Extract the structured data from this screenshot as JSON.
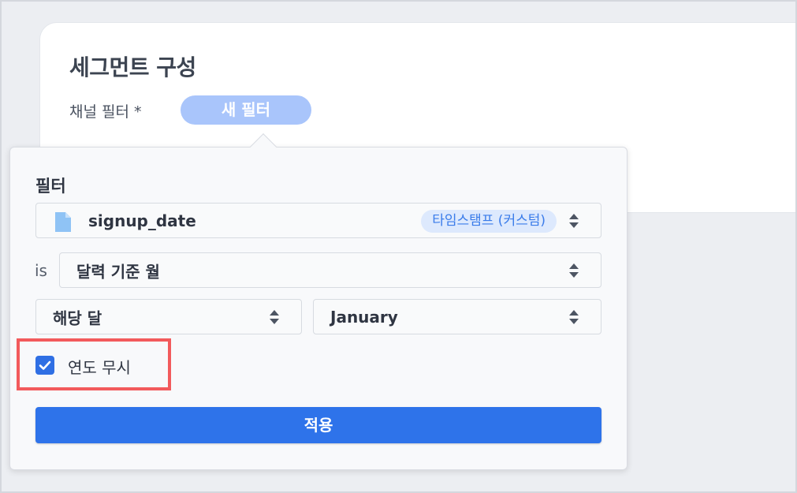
{
  "segment": {
    "title": "세그먼트 구성",
    "channel_filter_label": "채널 필터 *",
    "new_filter_button": "새 필터"
  },
  "filter_popover": {
    "heading": "필터",
    "column": {
      "name": "signup_date",
      "type_badge": "타임스탬프 (커스텀)",
      "icon": "file-icon"
    },
    "operator_label": "is",
    "operator_value": "달력 기준 월",
    "period_value": "해당 달",
    "month_value": "January",
    "ignore_year": {
      "label": "연도 무시",
      "checked": true
    },
    "apply_button": "적용"
  },
  "colors": {
    "accent": "#2e73ea",
    "new_filter_bg": "#a9c5fb",
    "badge_bg": "#dde9fd",
    "highlight": "#f25a5c"
  }
}
